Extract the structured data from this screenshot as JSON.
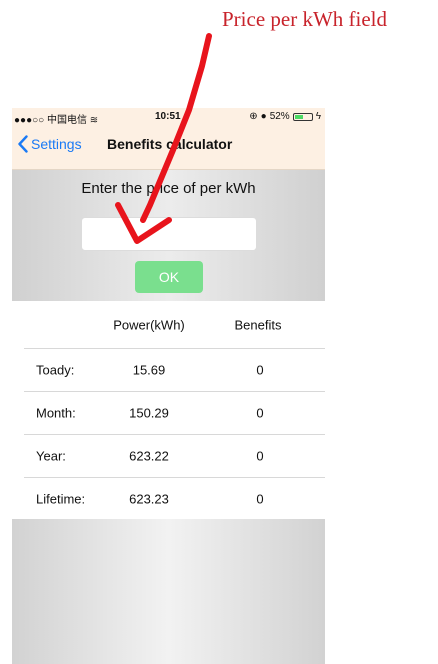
{
  "annotation": {
    "label": "Price per kWh field",
    "color": "#c8232b"
  },
  "statusbar": {
    "carrier": "●●●○○ 中国电信 ",
    "wifi_icon": "wifi-icon",
    "time": "10:5",
    "time_suffix": "1",
    "battery_percent": "52%",
    "battery_level": 0.52
  },
  "navbar": {
    "back_label": "Settings",
    "title": "Benefits calculator",
    "accent": "#1a7af5"
  },
  "calculator": {
    "prompt": "Enter the price of per kWh",
    "input_value": "",
    "input_placeholder": "",
    "ok_label": "OK",
    "ok_color": "#7adf8e"
  },
  "table": {
    "headers": {
      "label": "",
      "power": "Power(kWh)",
      "benefits": "Benefits"
    },
    "rows": [
      {
        "label": "Toady:",
        "power": "15.69",
        "benefits": "0"
      },
      {
        "label": "Month:",
        "power": "150.29",
        "benefits": "0"
      },
      {
        "label": "Year:",
        "power": "623.22",
        "benefits": "0"
      },
      {
        "label": "Lifetime:",
        "power": "623.23",
        "benefits": "0"
      }
    ]
  }
}
